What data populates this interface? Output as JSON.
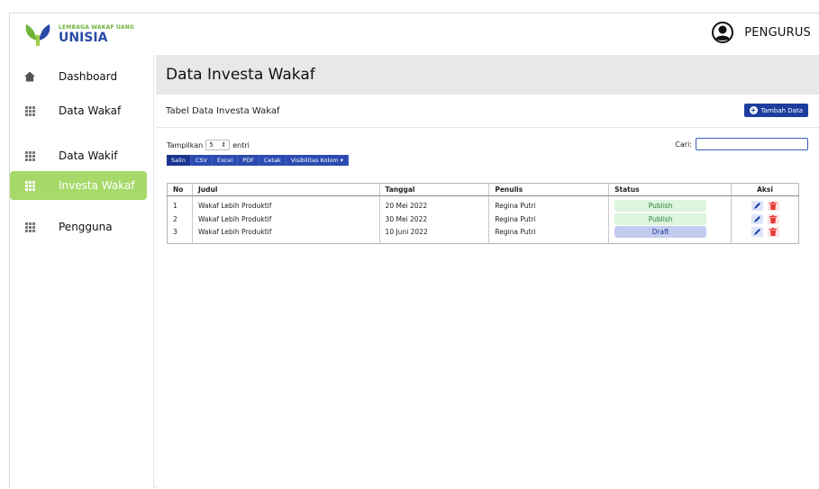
{
  "brand": {
    "tagline": "LEMBAGA WAKAF UANG",
    "name": "UNISIA"
  },
  "user": {
    "name": "PENGURUS"
  },
  "sidebar": {
    "items": [
      {
        "label": "Dashboard",
        "icon": "home-icon"
      },
      {
        "label": "Data Wakaf",
        "icon": "grid-icon"
      },
      {
        "label": "Data Wakif",
        "icon": "grid-icon"
      },
      {
        "label": "Investa Wakaf",
        "icon": "grid-icon",
        "active": true
      },
      {
        "label": "Pengguna",
        "icon": "grid-icon"
      }
    ]
  },
  "page": {
    "title": "Data Investa Wakaf"
  },
  "card": {
    "title": "Tabel Data Investa Wakaf",
    "add_label": "Tambah Data"
  },
  "controls": {
    "show_label": "Tampilkan",
    "show_value": "5",
    "entries_label": "entri",
    "search_label": "Cari:",
    "search_value": ""
  },
  "export_buttons": [
    "Salin",
    "CSV",
    "Excel",
    "PDF",
    "Cetak",
    "Visibilitas Kolom ▾"
  ],
  "table": {
    "headers": [
      "No",
      "Judul",
      "Tanggal",
      "Penulis",
      "Status",
      "Aksi"
    ],
    "rows": [
      {
        "no": "1",
        "judul": "Wakaf Lebih Produktif",
        "tanggal": "20 Mei 2022",
        "penulis": "Regina Putri",
        "status": "Publish"
      },
      {
        "no": "2",
        "judul": "Wakaf Lebih Produktif",
        "tanggal": "30 Mei 2022",
        "penulis": "Regina Putri",
        "status": "Publish"
      },
      {
        "no": "3",
        "judul": "Wakaf Lebih Produktif",
        "tanggal": "10 Juni 2022",
        "penulis": "Regina Putri",
        "status": "Draft"
      }
    ]
  },
  "colors": {
    "accent": "#1d3e9e",
    "active": "#a6d96a",
    "publish_bg": "#dcf5de",
    "draft_bg": "#c3ccee",
    "delete": "#e53935"
  }
}
